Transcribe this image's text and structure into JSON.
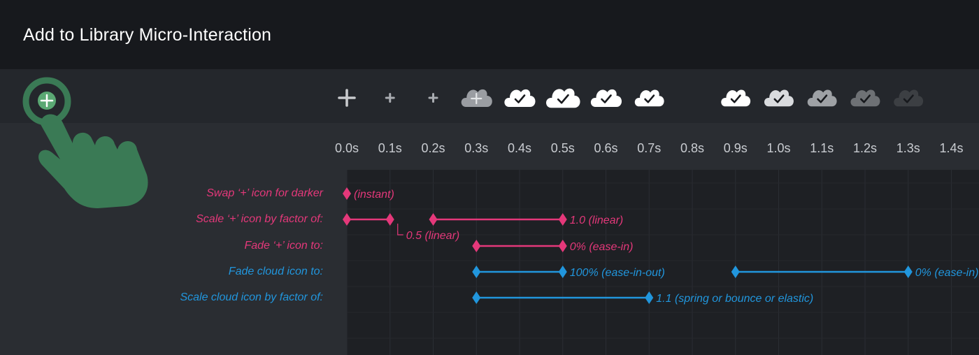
{
  "header": {
    "title": "Add to Library Micro-Interaction"
  },
  "colors": {
    "header_bg": "#17191d",
    "strip_bg": "#24272c",
    "page_bg": "#2a2d32",
    "grid_bg": "#1e2024",
    "pink": "#e4387a",
    "blue": "#2196dd",
    "hand": "#3a7a55",
    "hand_plus_bg": "#5aa873"
  },
  "icons": [
    {
      "t": 0.0,
      "kind": "plus",
      "tone": "#c8cacd",
      "size": 1.0
    },
    {
      "t": 0.1,
      "kind": "plus",
      "tone": "#a9acb1",
      "size": 0.5
    },
    {
      "t": 0.2,
      "kind": "plus",
      "tone": "#a9acb1",
      "size": 0.5
    },
    {
      "t": 0.3,
      "kind": "cloud-plus",
      "tone": "#9a9da2",
      "size": 1.0
    },
    {
      "t": 0.4,
      "kind": "cloud",
      "tone": "#ffffff",
      "size": 1.0
    },
    {
      "t": 0.5,
      "kind": "cloud",
      "tone": "#ffffff",
      "size": 1.1
    },
    {
      "t": 0.6,
      "kind": "cloud",
      "tone": "#ffffff",
      "size": 1.0
    },
    {
      "t": 0.7,
      "kind": "cloud",
      "tone": "#ffffff",
      "size": 0.95
    },
    {
      "t": 0.9,
      "kind": "cloud",
      "tone": "#ffffff",
      "size": 0.95
    },
    {
      "t": 1.0,
      "kind": "cloud",
      "tone": "#d9dbde",
      "size": 0.95
    },
    {
      "t": 1.1,
      "kind": "cloud",
      "tone": "#9ea1a5",
      "size": 0.95
    },
    {
      "t": 1.2,
      "kind": "cloud",
      "tone": "#6e7175",
      "size": 0.95
    },
    {
      "t": 1.3,
      "kind": "cloud",
      "tone": "#3c3f43",
      "size": 0.95
    }
  ],
  "chart_data": {
    "type": "timeline",
    "x_unit": "s",
    "xlim": [
      0.0,
      1.4
    ],
    "ticks": [
      "0.0s",
      "0.1s",
      "0.2s",
      "0.3s",
      "0.4s",
      "0.5s",
      "0.6s",
      "0.7s",
      "0.8s",
      "0.9s",
      "1.0s",
      "1.1s",
      "1.2s",
      "1.3s",
      "1.4s"
    ],
    "tracks": [
      {
        "label": "Swap ‘+’ icon for darker",
        "color": "#e4387a",
        "keyframes": [
          0.0
        ],
        "segments": [],
        "annotations": [
          {
            "at": 0.0,
            "text": "(instant)",
            "pos": "right"
          }
        ]
      },
      {
        "label": "Scale ‘+’ icon by factor of:",
        "color": "#e4387a",
        "keyframes": [
          0.0,
          0.1,
          0.2,
          0.5
        ],
        "segments": [
          [
            0.0,
            0.1
          ],
          [
            0.2,
            0.5
          ]
        ],
        "annotations": [
          {
            "at": 0.1,
            "text": "0.5 (linear)",
            "pos": "below"
          },
          {
            "at": 0.5,
            "text": "1.0 (linear)",
            "pos": "right"
          }
        ]
      },
      {
        "label": "Fade ‘+’ icon to:",
        "color": "#e4387a",
        "keyframes": [
          0.3,
          0.5
        ],
        "segments": [
          [
            0.3,
            0.5
          ]
        ],
        "annotations": [
          {
            "at": 0.5,
            "text": "0% (ease-in)",
            "pos": "right"
          }
        ]
      },
      {
        "label": "Fade cloud icon to:",
        "color": "#2196dd",
        "keyframes": [
          0.3,
          0.5,
          0.9,
          1.3
        ],
        "segments": [
          [
            0.3,
            0.5
          ],
          [
            0.9,
            1.3
          ]
        ],
        "annotations": [
          {
            "at": 0.5,
            "text": "100% (ease-in-out)",
            "pos": "right"
          },
          {
            "at": 1.3,
            "text": "0% (ease-in)",
            "pos": "right"
          }
        ]
      },
      {
        "label": "Scale cloud icon by factor of:",
        "color": "#2196dd",
        "keyframes": [
          0.3,
          0.7
        ],
        "segments": [
          [
            0.3,
            0.7
          ]
        ],
        "annotations": [
          {
            "at": 0.7,
            "text": "1.1 (spring or bounce or elastic)",
            "pos": "right"
          }
        ]
      }
    ]
  }
}
